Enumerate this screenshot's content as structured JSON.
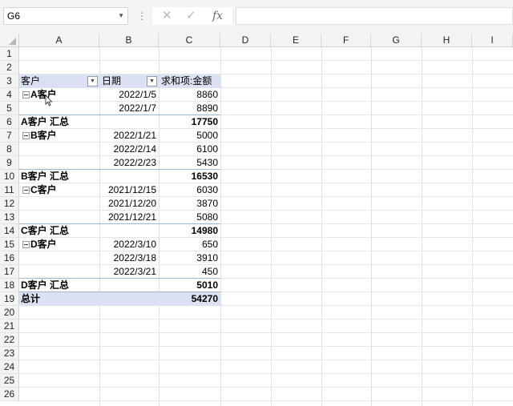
{
  "formula_bar": {
    "name_box": "G6",
    "cancel_icon": "✕",
    "enter_icon": "✓",
    "fx_label": "fx",
    "formula": ""
  },
  "columns": [
    "A",
    "B",
    "C",
    "D",
    "E",
    "F",
    "G",
    "H",
    "I"
  ],
  "rows": [
    "1",
    "2",
    "3",
    "4",
    "5",
    "6",
    "7",
    "8",
    "9",
    "10",
    "11",
    "12",
    "13",
    "14",
    "15",
    "16",
    "17",
    "18",
    "19",
    "20",
    "21",
    "22",
    "23",
    "24",
    "25",
    "26"
  ],
  "pivot": {
    "header": {
      "customer": "客户",
      "date": "日期",
      "sum": "求和项:金额"
    },
    "groups": [
      {
        "name": "A客户",
        "dates": [
          "2022/1/5",
          "2022/1/7"
        ],
        "amounts": [
          "8860",
          "8890"
        ],
        "subtotal_label": "A客户 汇总",
        "subtotal": "17750"
      },
      {
        "name": "B客户",
        "dates": [
          "2022/1/21",
          "2022/2/14",
          "2022/2/23"
        ],
        "amounts": [
          "5000",
          "6100",
          "5430"
        ],
        "subtotal_label": "B客户 汇总",
        "subtotal": "16530"
      },
      {
        "name": "C客户",
        "dates": [
          "2021/12/15",
          "2021/12/20",
          "2021/12/21"
        ],
        "amounts": [
          "6030",
          "3870",
          "5080"
        ],
        "subtotal_label": "C客户 汇总",
        "subtotal": "14980"
      },
      {
        "name": "D客户",
        "dates": [
          "2022/3/10",
          "2022/3/18",
          "2022/3/21"
        ],
        "amounts": [
          "650",
          "3910",
          "450"
        ],
        "subtotal_label": "D客户 汇总",
        "subtotal": "5010"
      }
    ],
    "grand_total_label": "总计",
    "grand_total": "54270"
  },
  "colors": {
    "pivot_header_fill": "#d9e1f2",
    "header_bg": "#f3f3f3",
    "grid_line": "#e1e1e1"
  }
}
